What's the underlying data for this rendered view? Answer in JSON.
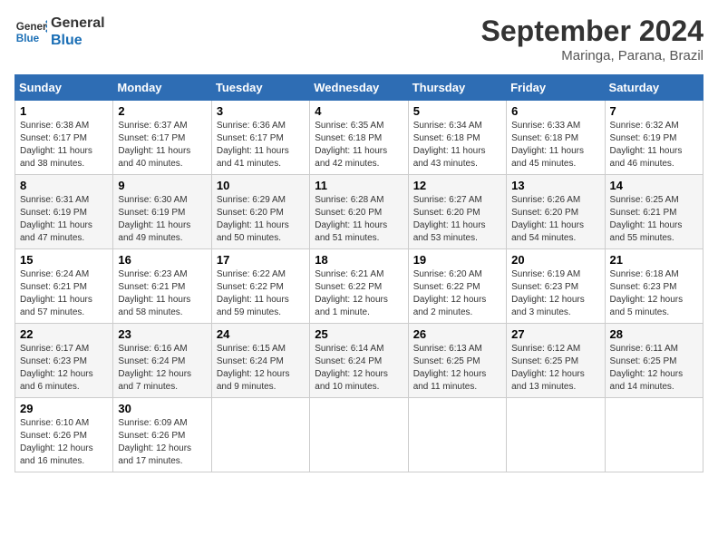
{
  "logo": {
    "line1": "General",
    "line2": "Blue"
  },
  "title": "September 2024",
  "location": "Maringa, Parana, Brazil",
  "weekdays": [
    "Sunday",
    "Monday",
    "Tuesday",
    "Wednesday",
    "Thursday",
    "Friday",
    "Saturday"
  ],
  "weeks": [
    [
      {
        "day": "1",
        "info": "Sunrise: 6:38 AM\nSunset: 6:17 PM\nDaylight: 11 hours\nand 38 minutes."
      },
      {
        "day": "2",
        "info": "Sunrise: 6:37 AM\nSunset: 6:17 PM\nDaylight: 11 hours\nand 40 minutes."
      },
      {
        "day": "3",
        "info": "Sunrise: 6:36 AM\nSunset: 6:17 PM\nDaylight: 11 hours\nand 41 minutes."
      },
      {
        "day": "4",
        "info": "Sunrise: 6:35 AM\nSunset: 6:18 PM\nDaylight: 11 hours\nand 42 minutes."
      },
      {
        "day": "5",
        "info": "Sunrise: 6:34 AM\nSunset: 6:18 PM\nDaylight: 11 hours\nand 43 minutes."
      },
      {
        "day": "6",
        "info": "Sunrise: 6:33 AM\nSunset: 6:18 PM\nDaylight: 11 hours\nand 45 minutes."
      },
      {
        "day": "7",
        "info": "Sunrise: 6:32 AM\nSunset: 6:19 PM\nDaylight: 11 hours\nand 46 minutes."
      }
    ],
    [
      {
        "day": "8",
        "info": "Sunrise: 6:31 AM\nSunset: 6:19 PM\nDaylight: 11 hours\nand 47 minutes."
      },
      {
        "day": "9",
        "info": "Sunrise: 6:30 AM\nSunset: 6:19 PM\nDaylight: 11 hours\nand 49 minutes."
      },
      {
        "day": "10",
        "info": "Sunrise: 6:29 AM\nSunset: 6:20 PM\nDaylight: 11 hours\nand 50 minutes."
      },
      {
        "day": "11",
        "info": "Sunrise: 6:28 AM\nSunset: 6:20 PM\nDaylight: 11 hours\nand 51 minutes."
      },
      {
        "day": "12",
        "info": "Sunrise: 6:27 AM\nSunset: 6:20 PM\nDaylight: 11 hours\nand 53 minutes."
      },
      {
        "day": "13",
        "info": "Sunrise: 6:26 AM\nSunset: 6:20 PM\nDaylight: 11 hours\nand 54 minutes."
      },
      {
        "day": "14",
        "info": "Sunrise: 6:25 AM\nSunset: 6:21 PM\nDaylight: 11 hours\nand 55 minutes."
      }
    ],
    [
      {
        "day": "15",
        "info": "Sunrise: 6:24 AM\nSunset: 6:21 PM\nDaylight: 11 hours\nand 57 minutes."
      },
      {
        "day": "16",
        "info": "Sunrise: 6:23 AM\nSunset: 6:21 PM\nDaylight: 11 hours\nand 58 minutes."
      },
      {
        "day": "17",
        "info": "Sunrise: 6:22 AM\nSunset: 6:22 PM\nDaylight: 11 hours\nand 59 minutes."
      },
      {
        "day": "18",
        "info": "Sunrise: 6:21 AM\nSunset: 6:22 PM\nDaylight: 12 hours\nand 1 minute."
      },
      {
        "day": "19",
        "info": "Sunrise: 6:20 AM\nSunset: 6:22 PM\nDaylight: 12 hours\nand 2 minutes."
      },
      {
        "day": "20",
        "info": "Sunrise: 6:19 AM\nSunset: 6:23 PM\nDaylight: 12 hours\nand 3 minutes."
      },
      {
        "day": "21",
        "info": "Sunrise: 6:18 AM\nSunset: 6:23 PM\nDaylight: 12 hours\nand 5 minutes."
      }
    ],
    [
      {
        "day": "22",
        "info": "Sunrise: 6:17 AM\nSunset: 6:23 PM\nDaylight: 12 hours\nand 6 minutes."
      },
      {
        "day": "23",
        "info": "Sunrise: 6:16 AM\nSunset: 6:24 PM\nDaylight: 12 hours\nand 7 minutes."
      },
      {
        "day": "24",
        "info": "Sunrise: 6:15 AM\nSunset: 6:24 PM\nDaylight: 12 hours\nand 9 minutes."
      },
      {
        "day": "25",
        "info": "Sunrise: 6:14 AM\nSunset: 6:24 PM\nDaylight: 12 hours\nand 10 minutes."
      },
      {
        "day": "26",
        "info": "Sunrise: 6:13 AM\nSunset: 6:25 PM\nDaylight: 12 hours\nand 11 minutes."
      },
      {
        "day": "27",
        "info": "Sunrise: 6:12 AM\nSunset: 6:25 PM\nDaylight: 12 hours\nand 13 minutes."
      },
      {
        "day": "28",
        "info": "Sunrise: 6:11 AM\nSunset: 6:25 PM\nDaylight: 12 hours\nand 14 minutes."
      }
    ],
    [
      {
        "day": "29",
        "info": "Sunrise: 6:10 AM\nSunset: 6:26 PM\nDaylight: 12 hours\nand 16 minutes."
      },
      {
        "day": "30",
        "info": "Sunrise: 6:09 AM\nSunset: 6:26 PM\nDaylight: 12 hours\nand 17 minutes."
      },
      {
        "day": "",
        "info": ""
      },
      {
        "day": "",
        "info": ""
      },
      {
        "day": "",
        "info": ""
      },
      {
        "day": "",
        "info": ""
      },
      {
        "day": "",
        "info": ""
      }
    ]
  ]
}
